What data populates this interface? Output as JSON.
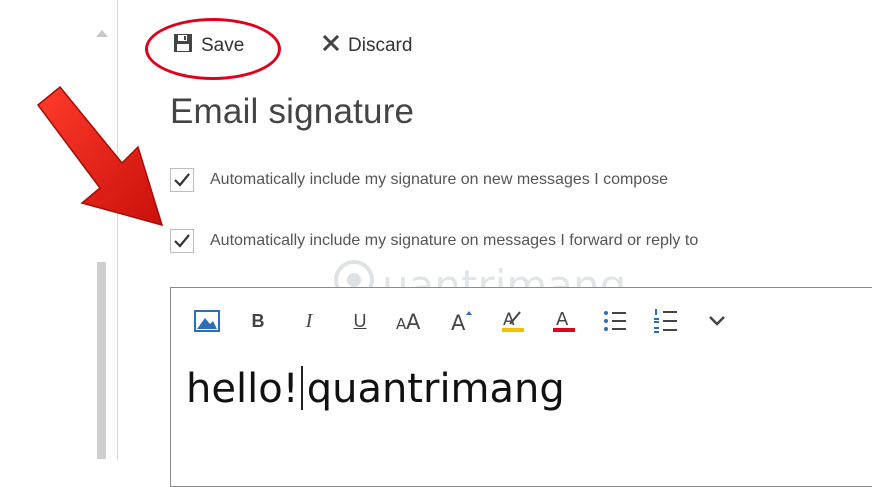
{
  "toolbar": {
    "save_label": "Save",
    "discard_label": "Discard"
  },
  "page": {
    "title": "Email signature"
  },
  "options": [
    {
      "label": "Automatically include my signature on new messages I compose",
      "checked": true
    },
    {
      "label": "Automatically include my signature on messages I forward or reply to",
      "checked": true
    }
  ],
  "editor": {
    "text_before_caret": "hello!",
    "text_after_caret": "quantrimang",
    "toolbar_icons": [
      "insert-picture-icon",
      "bold-icon",
      "italic-icon",
      "underline-icon",
      "font-size-icon",
      "grow-font-icon",
      "highlight-icon",
      "font-color-icon",
      "bullets-icon",
      "numbering-icon",
      "more-options-icon"
    ]
  },
  "watermark": {
    "text": "uantrimang"
  },
  "colors": {
    "annotation_red": "#e0001b",
    "arrow_red": "#e8261a",
    "highlight_yellow": "#f2c100",
    "font_color_red": "#e0001b",
    "picture_blue": "#2a6fb8"
  }
}
